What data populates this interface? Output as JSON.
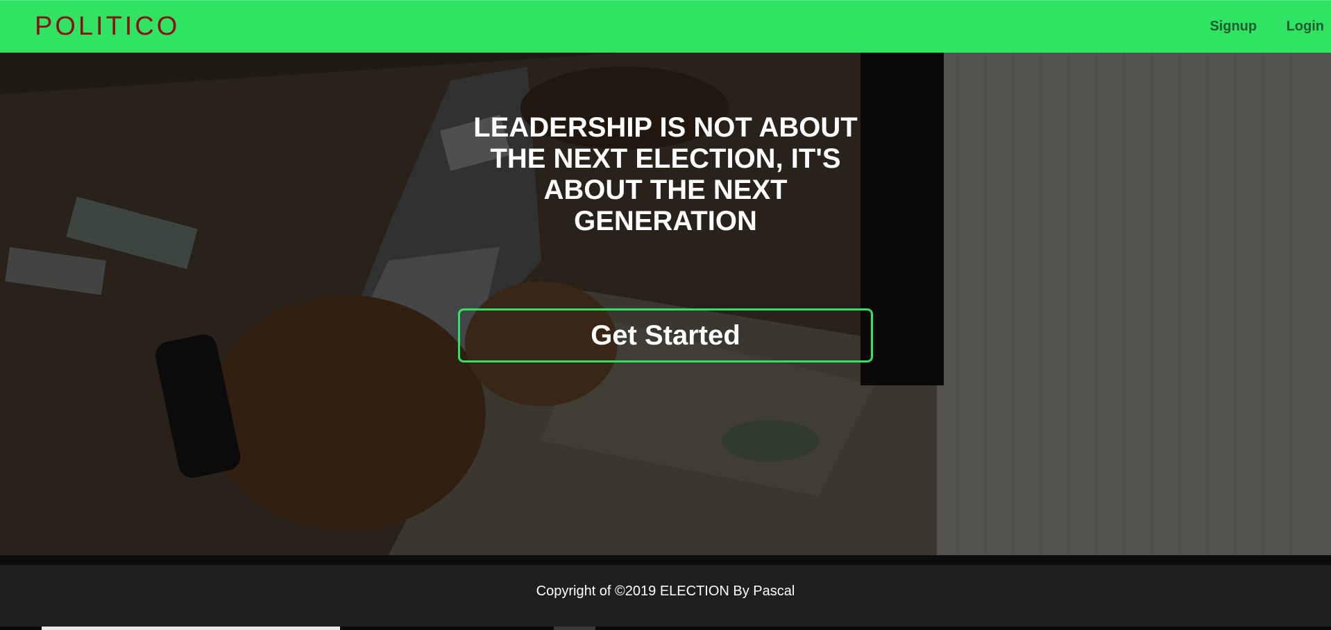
{
  "brand": {
    "logo_text": "POLITICO"
  },
  "nav": {
    "links": [
      {
        "label": "Signup"
      },
      {
        "label": "Login"
      }
    ]
  },
  "hero": {
    "headline": "LEADERSHIP IS NOT ABOUT THE NEXT ELECTION, IT'S ABOUT THE NEXT GENERATION",
    "cta_label": "Get Started"
  },
  "footer": {
    "copyright": "Copyright of ©2019 ELECTION By Pascal"
  },
  "colors": {
    "navbar_bg": "#31e362",
    "logo": "#8b0f13",
    "nav_link": "#1d5b30",
    "cta_border": "#31e362",
    "footer_bg": "#1f1f1f"
  }
}
